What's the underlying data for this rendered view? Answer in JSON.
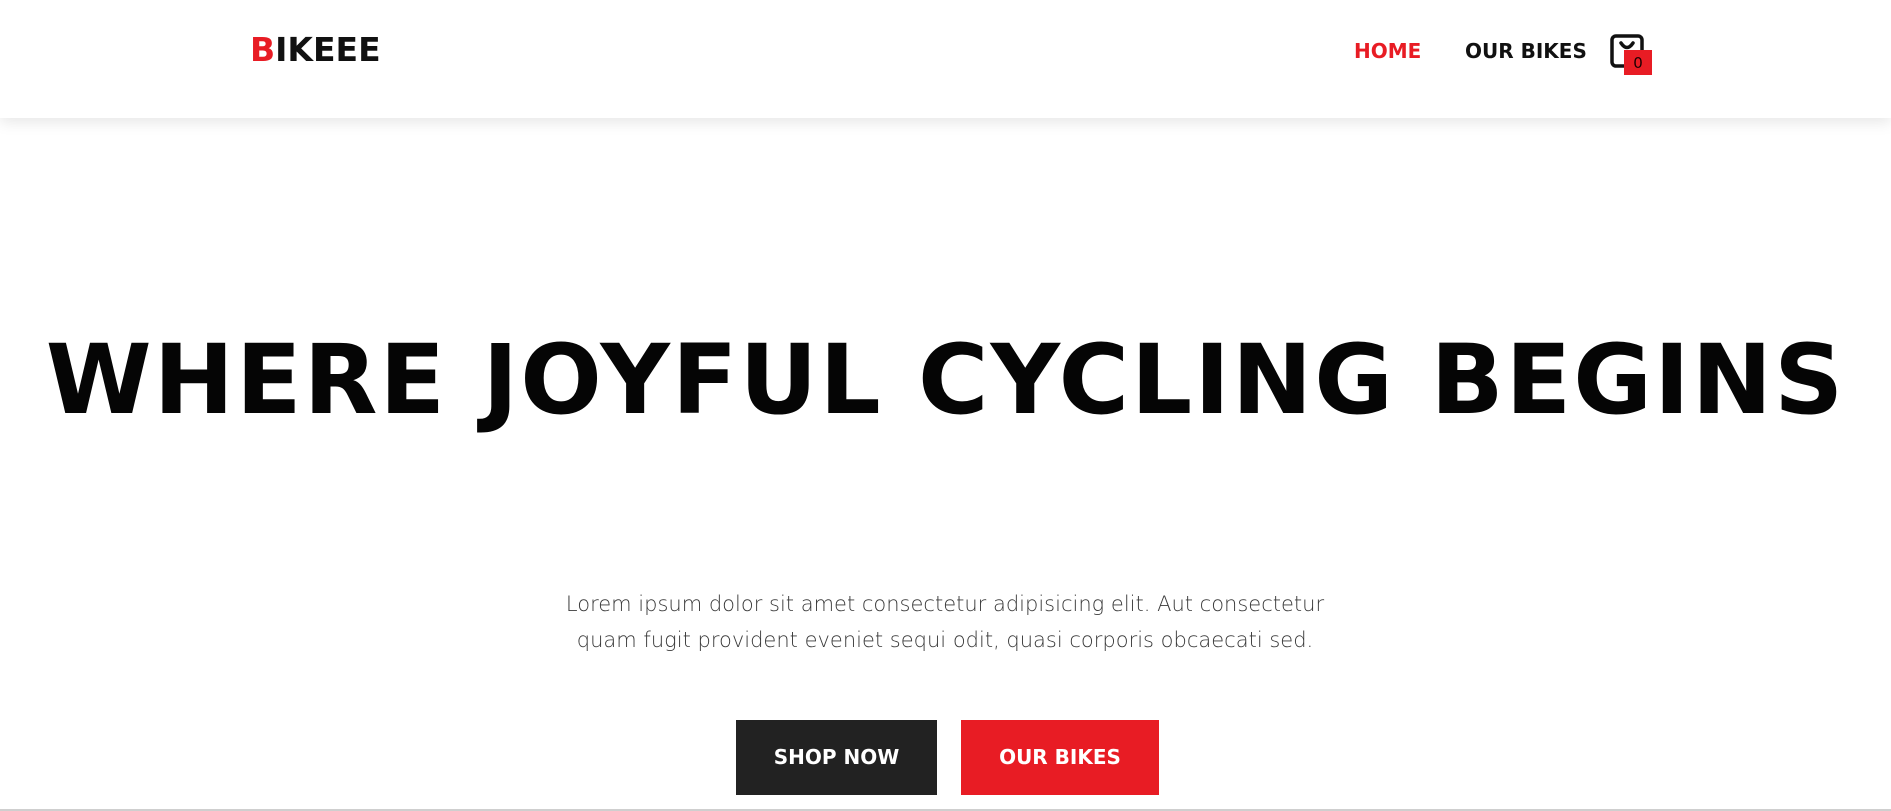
{
  "brand": {
    "first_letter": "B",
    "rest": "IKEEE",
    "accent_color": "#e81c24"
  },
  "nav": {
    "items": [
      {
        "label": "HOME",
        "active": true
      },
      {
        "label": "OUR BIKES",
        "active": false
      }
    ],
    "cart": {
      "icon": "shopping-bag-icon",
      "count": "0"
    }
  },
  "hero": {
    "title": "WHERE JOYFUL CYCLING BEGINS",
    "text": "Lorem ipsum dolor sit amet consectetur adipisicing elit. Aut consectetur quam fugit provident eveniet sequi odit, quasi corporis obcaecati sed.",
    "buttons": {
      "shop": "SHOP NOW",
      "bikes": "OUR BIKES"
    }
  },
  "colors": {
    "accent": "#e81c24",
    "dark_button": "#222222",
    "text": "#050505"
  }
}
